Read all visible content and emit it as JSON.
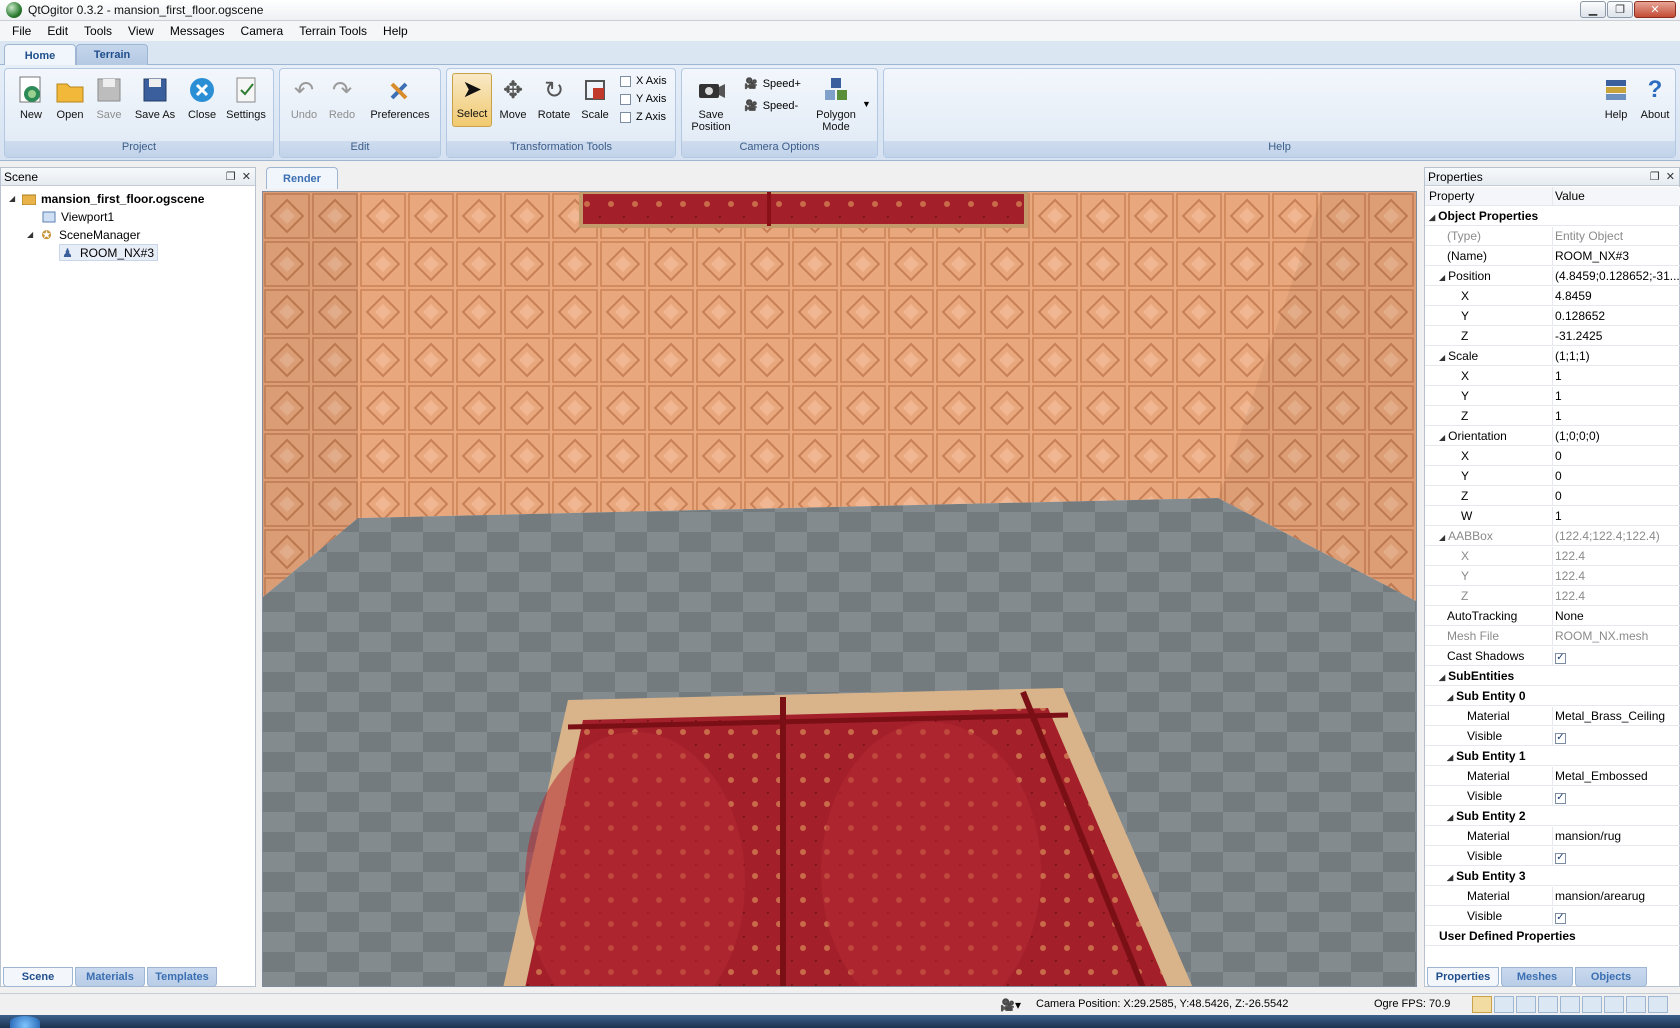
{
  "window": {
    "title": "QtOgitor 0.3.2 - mansion_first_floor.ogscene",
    "min": "▁",
    "max": "❐",
    "close": "✕"
  },
  "menu": [
    "File",
    "Edit",
    "Tools",
    "View",
    "Messages",
    "Camera",
    "Terrain Tools",
    "Help"
  ],
  "ribbon_tabs": {
    "home": "Home",
    "terrain": "Terrain"
  },
  "groups": {
    "project": {
      "label": "Project",
      "new": "New",
      "open": "Open",
      "save": "Save",
      "save_as": "Save As",
      "close": "Close",
      "settings": "Settings"
    },
    "edit": {
      "label": "Edit",
      "undo": "Undo",
      "redo": "Redo",
      "preferences": "Preferences"
    },
    "transform": {
      "label": "Transformation Tools",
      "select": "Select",
      "move": "Move",
      "rotate": "Rotate",
      "scale": "Scale",
      "x_axis": "X Axis",
      "y_axis": "Y Axis",
      "z_axis": "Z Axis"
    },
    "camera": {
      "label": "Camera Options",
      "save_position_1": "Save",
      "save_position_2": "Position",
      "speed_plus": "Speed+",
      "speed_minus": "Speed-",
      "polygon_mode_1": "Polygon",
      "polygon_mode_2": "Mode"
    },
    "help": {
      "label": "Help",
      "help": "Help",
      "about": "About"
    }
  },
  "scene_panel": {
    "title": "Scene",
    "tree": {
      "root": "mansion_first_floor.ogscene",
      "viewport": "Viewport1",
      "scene_manager": "SceneManager",
      "room": "ROOM_NX#3"
    },
    "tabs": {
      "scene": "Scene",
      "materials": "Materials",
      "templates": "Templates"
    }
  },
  "render_tab": "Render",
  "properties": {
    "title": "Properties",
    "header": {
      "property": "Property",
      "value": "Value"
    },
    "object_properties": "Object Properties",
    "type": {
      "name": "(Type)",
      "value": "Entity Object"
    },
    "name": {
      "name": "(Name)",
      "value": "ROOM_NX#3"
    },
    "position": {
      "name": "Position",
      "value": "(4.8459;0.128652;-31....",
      "x": "4.8459",
      "y": "0.128652",
      "z": "-31.2425"
    },
    "scale": {
      "name": "Scale",
      "value": "(1;1;1)",
      "x": "1",
      "y": "1",
      "z": "1"
    },
    "orientation": {
      "name": "Orientation",
      "value": "(1;0;0;0)",
      "x": "0",
      "y": "0",
      "z": "0",
      "w": "1"
    },
    "aabbox": {
      "name": "AABBox",
      "value": "(122.4;122.4;122.4)",
      "x": "122.4",
      "y": "122.4",
      "z": "122.4"
    },
    "axis": {
      "x": "X",
      "y": "Y",
      "z": "Z",
      "w": "W"
    },
    "autotracking": {
      "name": "AutoTracking",
      "value": "None"
    },
    "mesh_file": {
      "name": "Mesh File",
      "value": "ROOM_NX.mesh"
    },
    "cast_shadows": {
      "name": "Cast Shadows",
      "checked": "✓"
    },
    "subentities": "SubEntities",
    "material_label": "Material",
    "visible_label": "Visible",
    "check": "✓",
    "sub": [
      {
        "name": "Sub Entity 0",
        "material": "Metal_Brass_Ceiling"
      },
      {
        "name": "Sub Entity 1",
        "material": "Metal_Embossed"
      },
      {
        "name": "Sub Entity 2",
        "material": "mansion/rug"
      },
      {
        "name": "Sub Entity 3",
        "material": "mansion/arearug"
      }
    ],
    "user_defined": "User Defined Properties",
    "tabs": {
      "properties": "Properties",
      "meshes": "Meshes",
      "objects": "Objects"
    }
  },
  "status": {
    "camera_position": "Camera Position: X:29.2585, Y:48.5426, Z:-26.5542",
    "fps": "Ogre FPS: 70.9"
  },
  "colors": {
    "ribbon_blue": "#dbe6f3",
    "wall": "#e8a87c",
    "floor": "#8a9296",
    "rug": "#a3202a"
  }
}
